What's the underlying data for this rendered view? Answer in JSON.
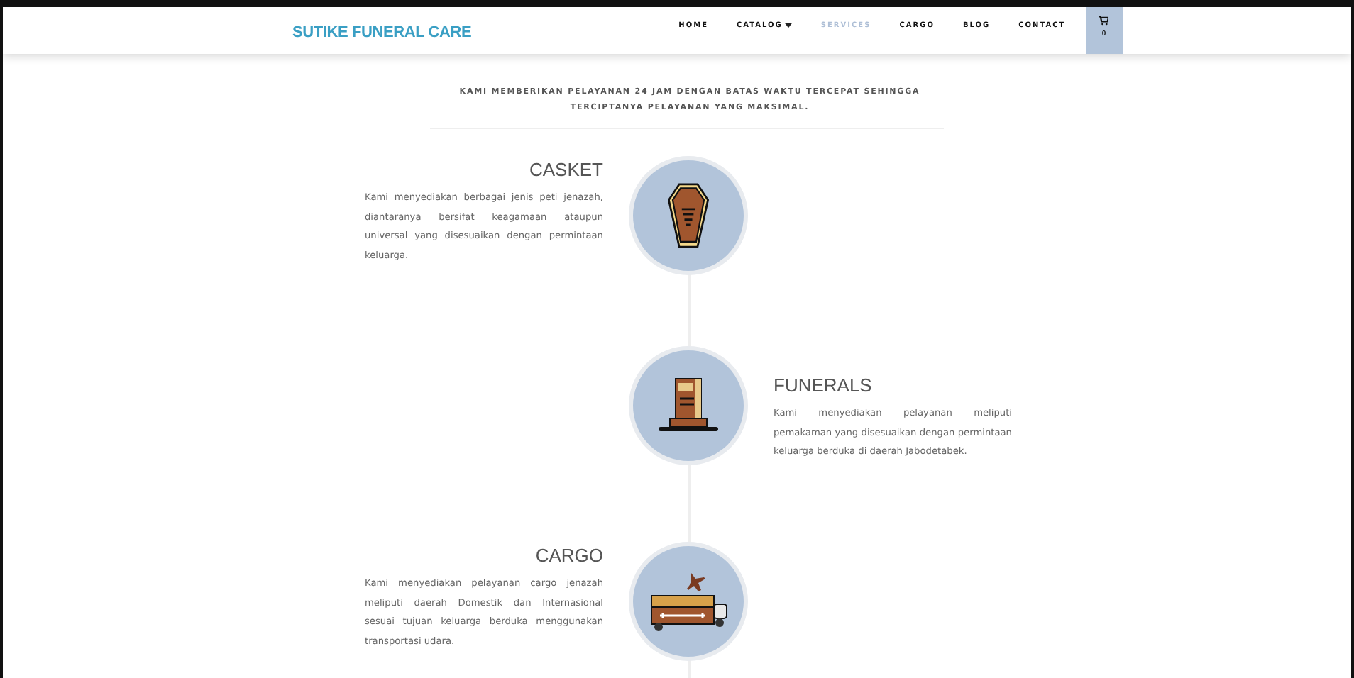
{
  "header": {
    "logo": "SUTIKE FUNERAL CARE",
    "nav": [
      {
        "label": "HOME",
        "selected": false,
        "dropdown": false
      },
      {
        "label": "CATALOG",
        "selected": false,
        "dropdown": true
      },
      {
        "label": "SERVICES",
        "selected": true,
        "dropdown": false
      },
      {
        "label": "CARGO",
        "selected": false,
        "dropdown": false
      },
      {
        "label": "BLOG",
        "selected": false,
        "dropdown": false
      },
      {
        "label": "CONTACT",
        "selected": false,
        "dropdown": false
      }
    ],
    "cart_count": "0"
  },
  "intro": "KAMI MEMBERIKAN PELAYANAN 24 JAM DENGAN BATAS WAKTU TERCEPAT SEHINGGA TERCIPTANYA PELAYANAN YANG MAKSIMAL.",
  "services": [
    {
      "title": "CASKET",
      "text": "Kami menyediakan berbagai jenis peti jenazah, diantaranya bersifat keagamaan ataupun universal yang disesuaikan dengan permintaan keluarga."
    },
    {
      "title": "FUNERALS",
      "text": "Kami menyediakan pelayanan meliputi pemakaman yang disesuaikan dengan permintaan keluarga berduka di daerah Jabodetabek."
    },
    {
      "title": "CARGO",
      "text": "Kami menyediakan pelayanan cargo jenazah meliputi daerah Domestik dan Internasional sesuai tujuan keluarga berduka menggunakan transportasi udara."
    }
  ]
}
